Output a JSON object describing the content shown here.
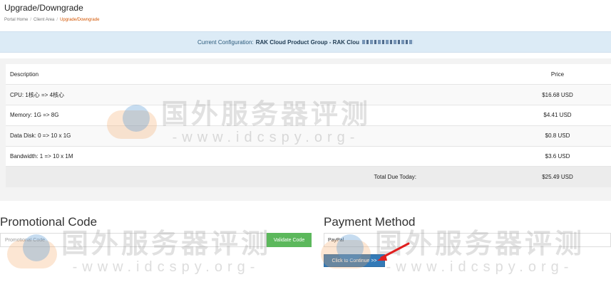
{
  "page": {
    "title": "Upgrade/Downgrade",
    "breadcrumb": [
      "Portal Home",
      "Client Area",
      "Upgrade/Downgrade"
    ],
    "breadcrumb_sep": "/"
  },
  "config": {
    "label": "Current Configuration:",
    "value": "RAK Cloud Product Group - RAK Clou"
  },
  "table": {
    "headers": {
      "description": "Description",
      "price": "Price"
    },
    "rows": [
      {
        "description": "CPU: 1核心 => 4核心",
        "price": "$16.68 USD"
      },
      {
        "description": "Memory: 1G => 8G",
        "price": "$4.41 USD"
      },
      {
        "description": "Data Disk: 0 => 10 x 1G",
        "price": "$0.8 USD"
      },
      {
        "description": "Bandwidth: 1 => 10 x 1M",
        "price": "$3.6 USD"
      }
    ],
    "total": {
      "label": "Total Due Today:",
      "price": "$25.49 USD"
    }
  },
  "promo": {
    "title": "Promotional Code",
    "placeholder": "Promotional Code",
    "validate_label": "Validate Code"
  },
  "payment": {
    "title": "Payment Method",
    "selected": "PayPal",
    "continue_label": "Click to Continue >>"
  },
  "watermark": {
    "cn": "国外服务器评测",
    "url": "-www.idcspy.org-"
  },
  "colors": {
    "config_bg": "#dcebf6",
    "validate": "#5cb85c",
    "continue": "#337ab7",
    "breadcrumb_active": "#d35400",
    "arrow": "#e02020"
  }
}
